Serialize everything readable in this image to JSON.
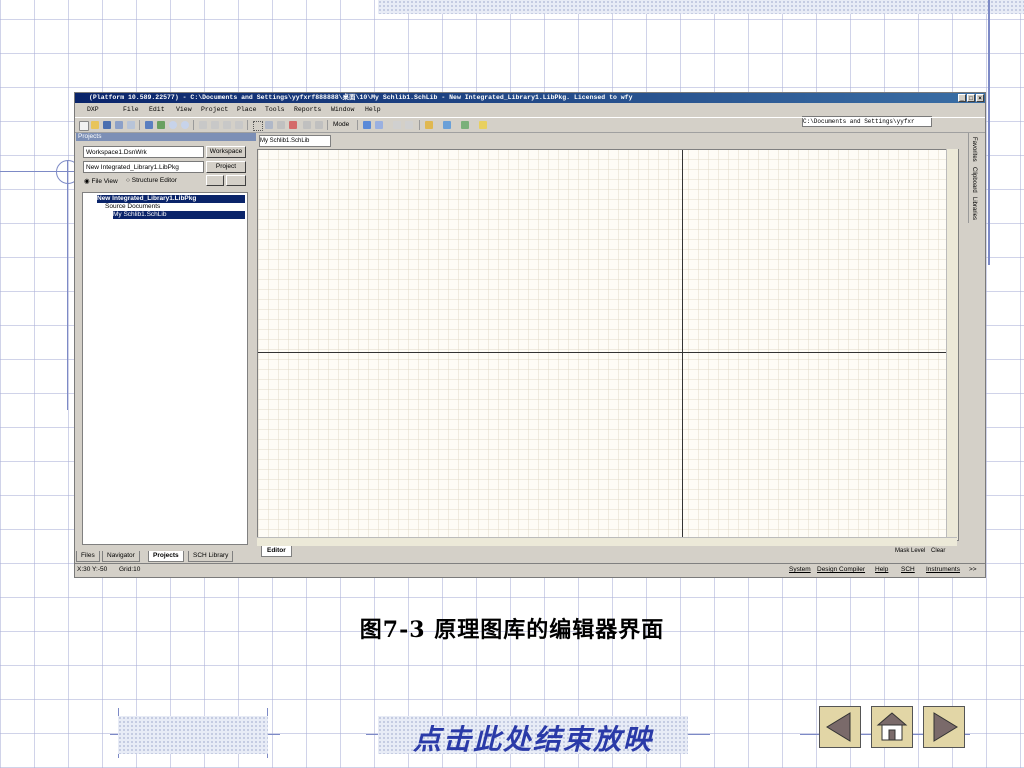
{
  "app": {
    "title": "(Platform 10.589.22577) - C:\\Documents and Settings\\yyfxrf888888\\桌面\\10\\My Schlib1.SchLib - New Integrated_Library1.LibPkg. Licensed to wfy",
    "menus": [
      "DXP",
      "File",
      "Edit",
      "View",
      "Project",
      "Place",
      "Tools",
      "Reports",
      "Window",
      "Help"
    ],
    "path_field": "C:\\Documents and Settings\\yyfxr",
    "toolbar_mode": "Mode"
  },
  "panel": {
    "title": "Projects",
    "workspace_combo": "Workspace1.DsnWrk",
    "workspace_button": "Workspace",
    "project_field": "New Integrated_Library1.LibPkg",
    "project_button": "Project",
    "radio_fileview": "File View",
    "radio_structure": "Structure Editor",
    "tree": {
      "root": "New Integrated_Library1.LibPkg",
      "folder": "Source Documents",
      "file": "My Schlib1.SchLib"
    },
    "tabs": [
      "Files",
      "Navigator",
      "Projects",
      "SCH Library"
    ]
  },
  "editor": {
    "doc_tab": "My Schlib1.SchLib",
    "bottom_tab": "Editor",
    "mask_level": "Mask Level",
    "clear": "Clear",
    "side_tabs": [
      "Favorites",
      "Clipboard",
      "Libraries"
    ]
  },
  "statusbar": {
    "coords": "X:30 Y:-50",
    "grid": "Grid:10",
    "items": [
      "System",
      "Design Compiler",
      "Help",
      "SCH",
      "Instruments",
      ">>"
    ]
  },
  "caption": "图7-3  原理图库的编辑器界面",
  "end_show": "点击此处结束放映",
  "nav": {
    "prev_icon": "left-arrow-icon",
    "home_icon": "home-icon",
    "next_icon": "right-arrow-icon"
  },
  "colors": {
    "grid_lines": "#aaafd7",
    "title_bar": "#0a246a",
    "selection": "#0a246a",
    "end_label": "#2a3aa8",
    "nav_button": "#e2d6a6"
  }
}
